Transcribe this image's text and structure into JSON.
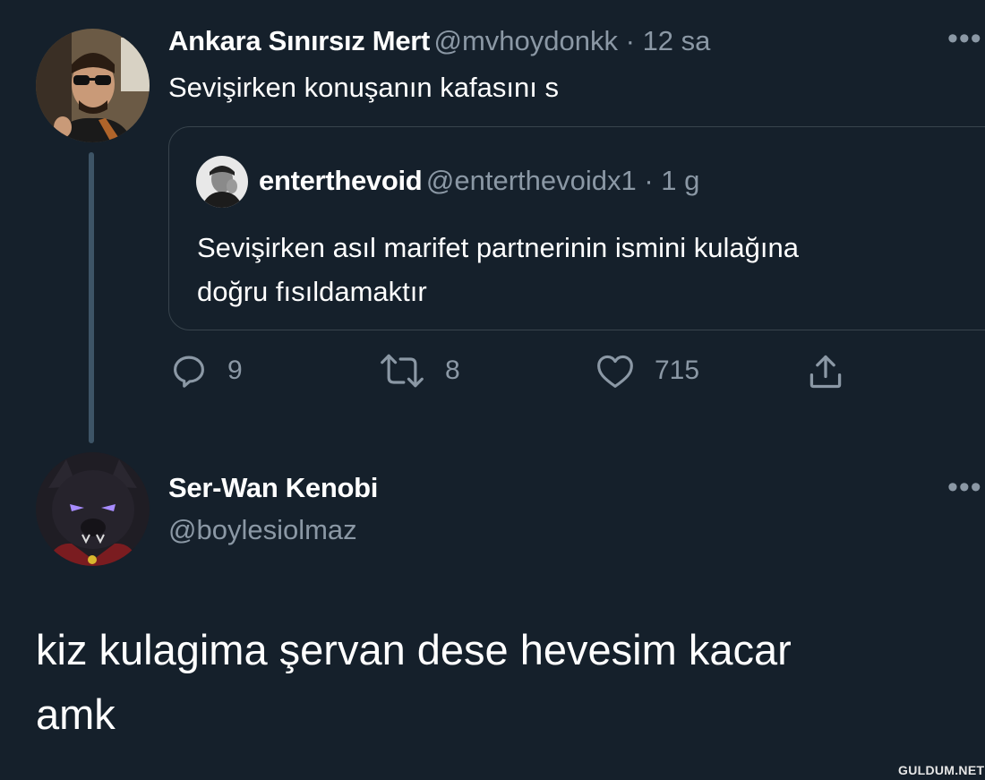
{
  "parent_tweet": {
    "author_name": "Ankara Sınırsız Mert",
    "handle": "@mvhoydonkk",
    "separator": " · ",
    "time": "12 sa",
    "text": "Sevişirken konuşanın kafasını s",
    "more_icon": "more-horizontal-icon"
  },
  "quoted_tweet": {
    "author_name": "enterthevoid",
    "handle": "@enterthevoidx1",
    "separator": " · ",
    "time": "1 g",
    "text_line1": "Sevişirken asıl marifet partnerinin ismini kulağına",
    "text_line2": "doğru fısıldamaktır"
  },
  "actions": {
    "reply": {
      "icon": "reply-icon",
      "count": "9"
    },
    "retweet": {
      "icon": "retweet-icon",
      "count": "8"
    },
    "like": {
      "icon": "heart-icon",
      "count": "715"
    },
    "share": {
      "icon": "share-icon"
    }
  },
  "reply_tweet": {
    "author_name": "Ser-Wan Kenobi",
    "handle": "@boylesiolmaz",
    "text_line1": "kiz kulagima şervan dese hevesim kacar",
    "text_line2": "amk",
    "more_icon": "more-horizontal-icon"
  },
  "watermark": "GULDUM.NET",
  "colors": {
    "background": "#15202b",
    "secondary_text": "#8b98a5",
    "border": "#38444d",
    "thread_line": "#3d5466"
  }
}
